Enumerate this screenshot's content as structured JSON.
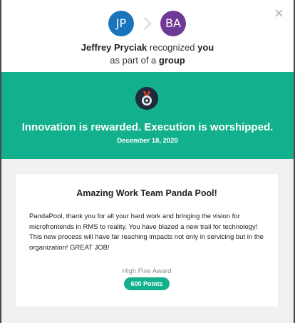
{
  "recognition": {
    "giver": {
      "initials": "JP",
      "color": "#1a74ba",
      "name": "Jeffrey Pryciak"
    },
    "receiver": {
      "initials": "BA",
      "color": "#6f3a95"
    },
    "text_recognized": " recognized ",
    "text_you": "you",
    "text_part_of": "as part of a ",
    "text_group": "group"
  },
  "highlight": {
    "color": "#13b08e",
    "quote": "Innovation is rewarded. Execution is worshipped.",
    "date": "December 18, 2020",
    "badge_icon": "medal-icon"
  },
  "card": {
    "title": "Amazing Work Team Panda Pool!",
    "message": "PandaPool, thank you for all your hard work and bringing the vision for microfrontends in RMS to reality. You have blazed a new trail for technology! This new process will have far reaching impacts not only in servicing but in the organization! GREAT JOB!",
    "award_type": "High Five Award",
    "points": "600 Points"
  },
  "icons": {
    "close": "close-icon",
    "arrow": "chevron-right-icon"
  }
}
